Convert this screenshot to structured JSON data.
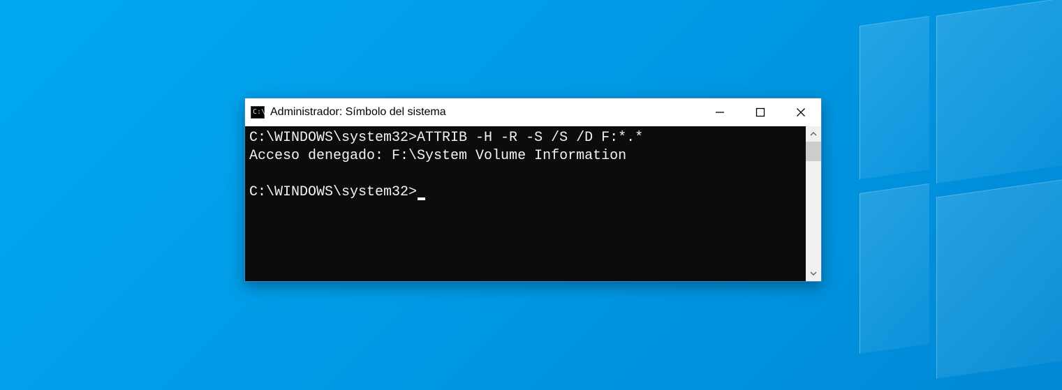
{
  "window": {
    "title": "Administrador: Símbolo del sistema",
    "icon_text": "C:\\."
  },
  "terminal": {
    "lines": [
      {
        "prompt": "C:\\WINDOWS\\system32>",
        "command": "ATTRIB -H -R -S /S /D F:*.*"
      },
      {
        "text": "Acceso denegado: F:\\System Volume Information"
      },
      {
        "blank": true
      },
      {
        "prompt": "C:\\WINDOWS\\system32>",
        "cursor": true
      }
    ]
  },
  "controls": {
    "minimize": "minimize",
    "maximize": "maximize",
    "close": "close"
  }
}
